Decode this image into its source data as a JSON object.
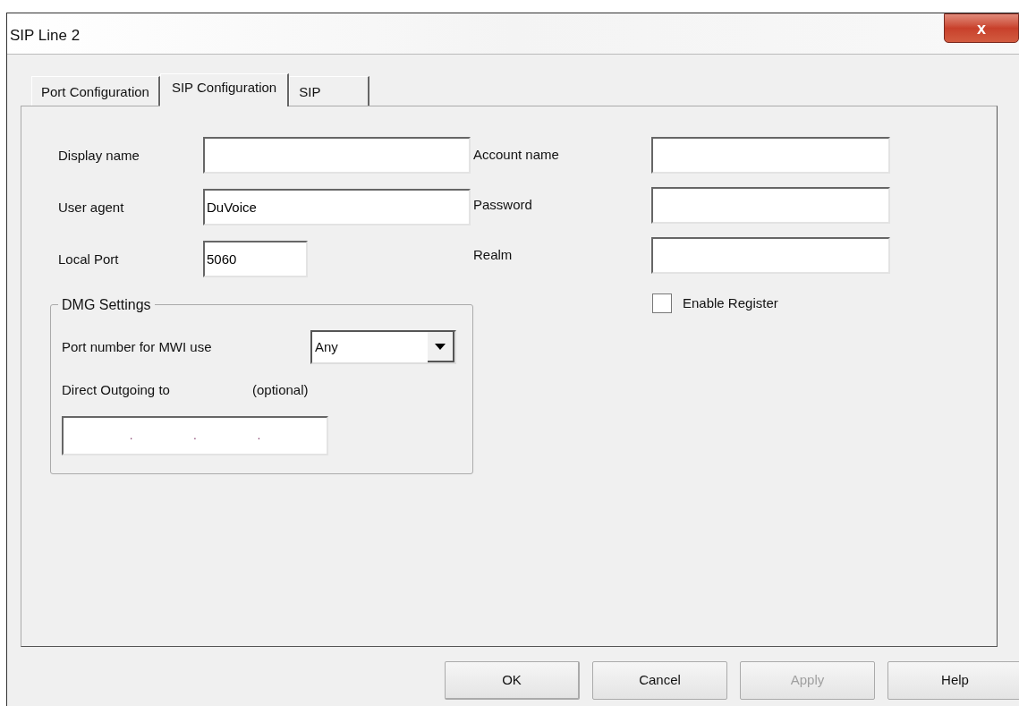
{
  "window": {
    "title": "SIP Line 2",
    "close": "x"
  },
  "tabs": [
    {
      "label": "Port Configuration",
      "selected": false
    },
    {
      "label": "SIP Configuration",
      "selected": true
    },
    {
      "label": "SIP",
      "selected": false
    }
  ],
  "left_fields": [
    {
      "label": "Display name",
      "kind": "wide"
    },
    {
      "label": "User agent",
      "value": "DuVoice",
      "kind": "wide"
    },
    {
      "label": "Local Port",
      "value": "5060",
      "kind": "short"
    }
  ],
  "right_fields": [
    {
      "label": "Account name"
    },
    {
      "label": "Password"
    },
    {
      "label": "Realm"
    }
  ],
  "enable_register": {
    "label": "Enable Register",
    "checked": false
  },
  "dmg_settings": {
    "title": "DMG Settings",
    "mwi_label": "Port number for MWI use",
    "mwi_value": "Any",
    "outgoing_label": "Direct Outgoing to",
    "optional_label": "(optional)",
    "ip_separator": "."
  },
  "buttons": [
    {
      "label": "OK",
      "disabled": false,
      "default": true
    },
    {
      "label": "Cancel",
      "disabled": false,
      "default": false
    },
    {
      "label": "Apply",
      "disabled": true,
      "default": false
    },
    {
      "label": "Help",
      "disabled": false,
      "default": false
    }
  ]
}
